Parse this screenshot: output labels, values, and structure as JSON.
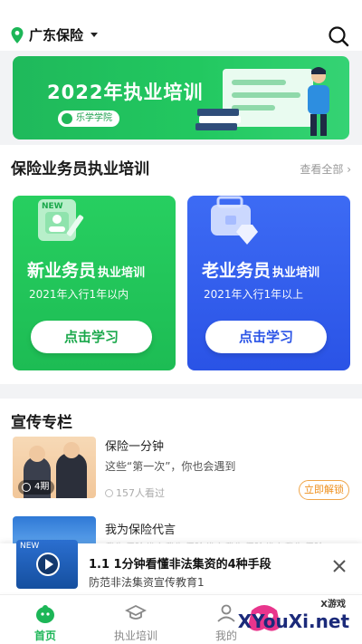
{
  "header": {
    "location": "广东保险"
  },
  "banner": {
    "title": "2022年执业培训",
    "brand": "乐学学院"
  },
  "training": {
    "title": "保险业务员执业培训",
    "view_all": "查看全部",
    "cards": [
      {
        "title": "新业务员",
        "suffix": "执业培训",
        "subtitle": "2021年入行1年以内",
        "button": "点击学习",
        "badge": "NEW"
      },
      {
        "title": "老业务员",
        "suffix": "执业培训",
        "subtitle": "2021年入行1年以上",
        "button": "点击学习"
      }
    ]
  },
  "column": {
    "title": "宣传专栏",
    "articles": [
      {
        "title": "保险一分钟",
        "desc": "这些“第一次”，你也会遇到",
        "views": "157人看过",
        "episodes": "4期",
        "action": "立即解锁"
      },
      {
        "title": "我为保险代言",
        "desc": "我为保险代言我为保险代言我为保险代言我为保险"
      }
    ]
  },
  "player": {
    "title": "1.1 1分钟看懂非法集资的4种手段",
    "subtitle": "防范非法集资宣传教育1",
    "thumb_badge": "NEW"
  },
  "tabbar": {
    "tabs": [
      {
        "label": "首页"
      },
      {
        "label": "执业培训"
      },
      {
        "label": "我的"
      }
    ]
  },
  "watermark": {
    "text": "XYouXi.net",
    "small": "X游戏"
  },
  "colors": {
    "accent": "#1cb657",
    "blue": "#2a53e6",
    "orange": "#ee8f1c"
  }
}
